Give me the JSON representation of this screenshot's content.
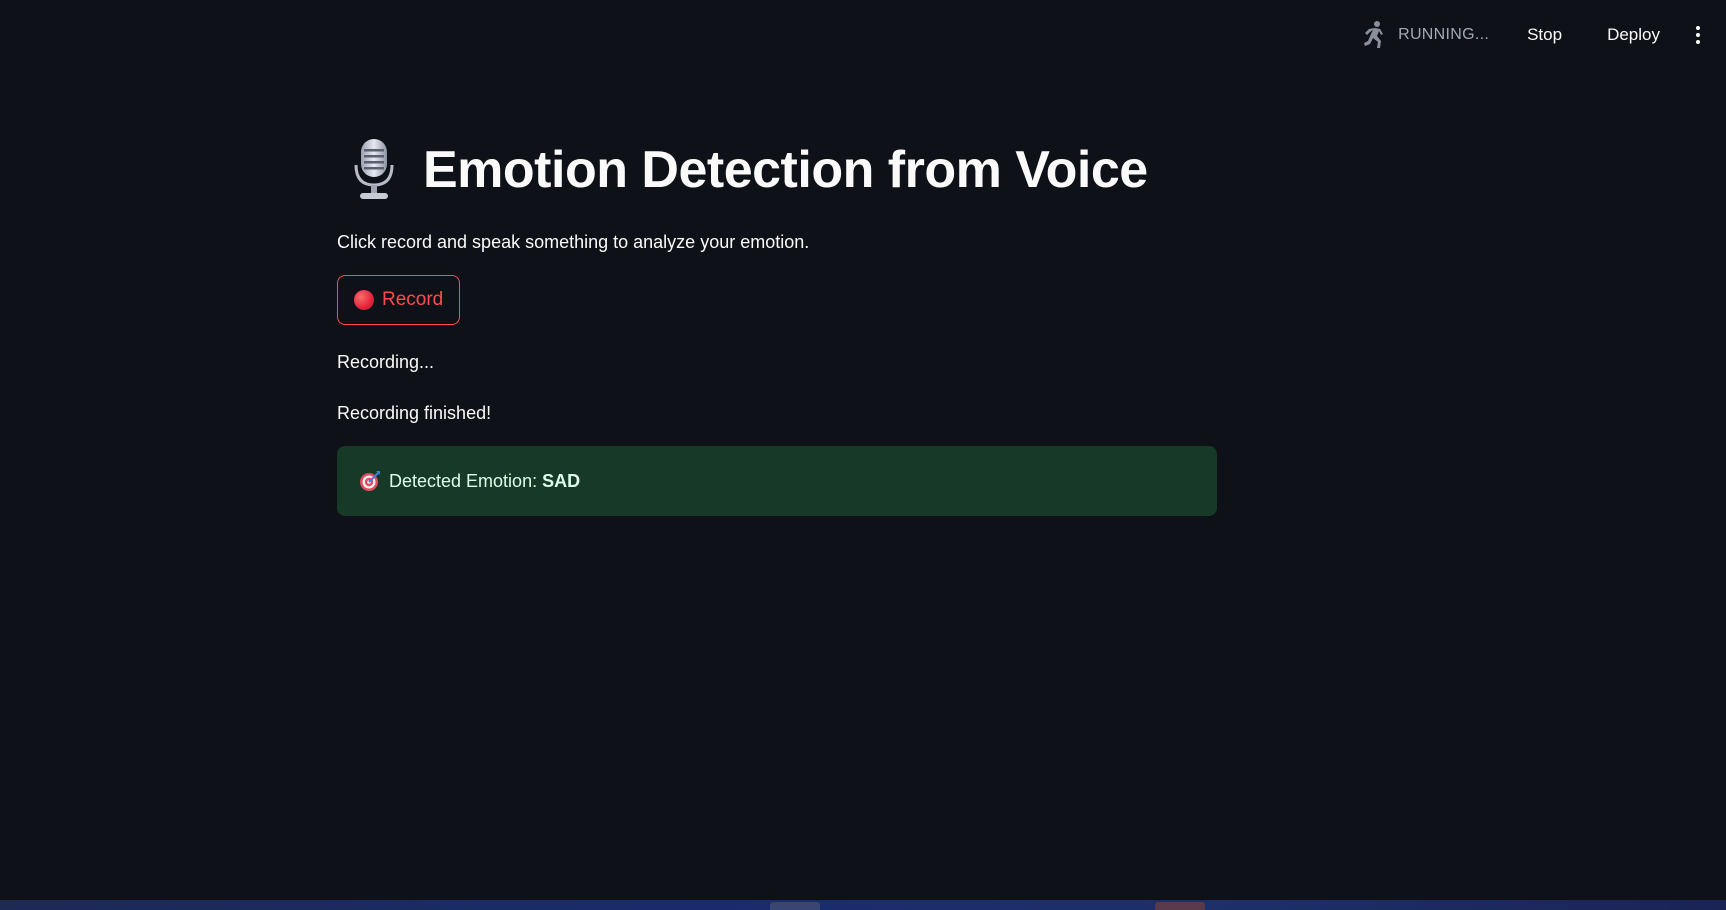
{
  "toolbar": {
    "status_text": "RUNNING...",
    "status_icon": "running-man-icon",
    "stop_label": "Stop",
    "deploy_label": "Deploy",
    "menu_icon": "kebab-menu-icon"
  },
  "main": {
    "title_icon": "microphone-icon",
    "title": "Emotion Detection from Voice",
    "subtitle": "Click record and speak something to analyze your emotion.",
    "record_button": {
      "icon": "red-circle-icon",
      "label": "Record"
    },
    "recording_text": "Recording...",
    "finished_text": "Recording finished!",
    "result": {
      "icon": "target-icon",
      "label": "Detected Emotion:",
      "value": "SAD"
    }
  },
  "colors": {
    "background": "#0e1117",
    "accent_red": "#ff4b4b",
    "success_bg": "#173928",
    "success_text": "#dffde9"
  }
}
